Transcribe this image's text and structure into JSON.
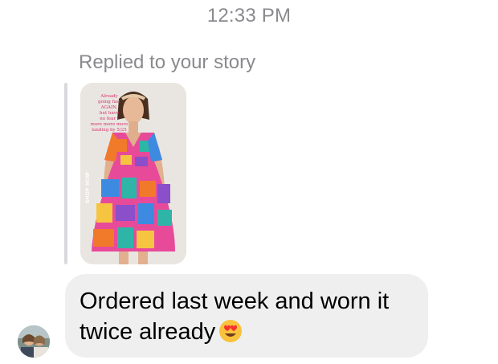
{
  "header": {
    "timestamp": "12:33 PM"
  },
  "story_reply": {
    "label": "Replied to your story",
    "story": {
      "caption_lines": [
        "Already",
        "going fast",
        "AGAIN,",
        "but have",
        "no fear -",
        "more more more",
        "landing by 5/25"
      ],
      "shop_button_label": "SHOP NOW",
      "dress_colors": [
        "#e84a9a",
        "#f07a2a",
        "#2fb5a8",
        "#8a4fc9",
        "#f5c542",
        "#3c8be0"
      ]
    }
  },
  "message": {
    "text": "Ordered last week and worn it twice already",
    "emoji": "heart-eyes-emoji",
    "bubble_color": "#efefef"
  },
  "sender": {
    "avatar": "sender-avatar"
  }
}
